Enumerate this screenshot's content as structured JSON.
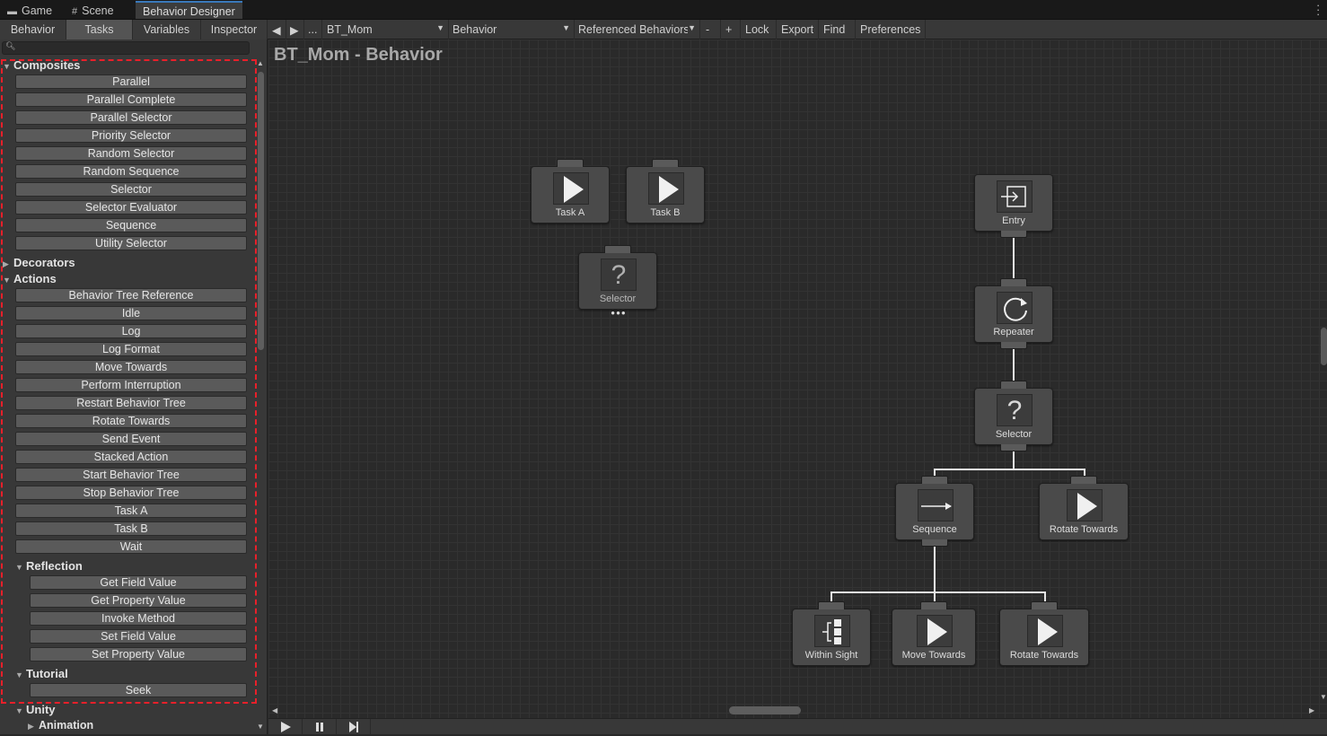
{
  "window_tabs": [
    {
      "label": "Game",
      "icon": "gamepad-icon"
    },
    {
      "label": "Scene",
      "icon": "grid-icon"
    },
    {
      "label": "Behavior Designer",
      "icon": ""
    }
  ],
  "panel_tabs": [
    "Behavior",
    "Tasks",
    "Variables",
    "Inspector"
  ],
  "toolbar": {
    "ellipsis": "...",
    "tree_dropdown": "BT_Mom",
    "behavior_dropdown": "Behavior",
    "referenced_dropdown": "Referenced Behaviors",
    "minus": "-",
    "plus": "+",
    "lock": "Lock",
    "export": "Export",
    "find": "Find",
    "preferences": "Preferences"
  },
  "search": {
    "placeholder": ""
  },
  "categories": {
    "composites": "Composites",
    "decorators": "Decorators",
    "actions": "Actions",
    "reflection": "Reflection",
    "tutorial": "Tutorial",
    "unity": "Unity",
    "animation": "Animation"
  },
  "composites": [
    "Parallel",
    "Parallel Complete",
    "Parallel Selector",
    "Priority Selector",
    "Random Selector",
    "Random Sequence",
    "Selector",
    "Selector Evaluator",
    "Sequence",
    "Utility Selector"
  ],
  "actions": [
    "Behavior Tree Reference",
    "Idle",
    "Log",
    "Log Format",
    "Move Towards",
    "Perform Interruption",
    "Restart Behavior Tree",
    "Rotate Towards",
    "Send Event",
    "Stacked Action",
    "Start Behavior Tree",
    "Stop Behavior Tree",
    "Task A",
    "Task B",
    "Wait"
  ],
  "reflection": [
    "Get Field Value",
    "Get Property Value",
    "Invoke Method",
    "Set Field Value",
    "Set Property Value"
  ],
  "tutorial": [
    "Seek"
  ],
  "graph": {
    "title": "BT_Mom - Behavior",
    "nodes": {
      "task_a": "Task A",
      "task_b": "Task B",
      "orphan_selector": "Selector",
      "entry": "Entry",
      "repeater": "Repeater",
      "selector": "Selector",
      "sequence": "Sequence",
      "rotate_towards_1": "Rotate Towards",
      "within_sight": "Within Sight",
      "move_towards": "Move Towards",
      "rotate_towards_2": "Rotate Towards"
    }
  },
  "colors": {
    "highlight": "#e8202a",
    "active_tab_accent": "#3a79bb"
  }
}
